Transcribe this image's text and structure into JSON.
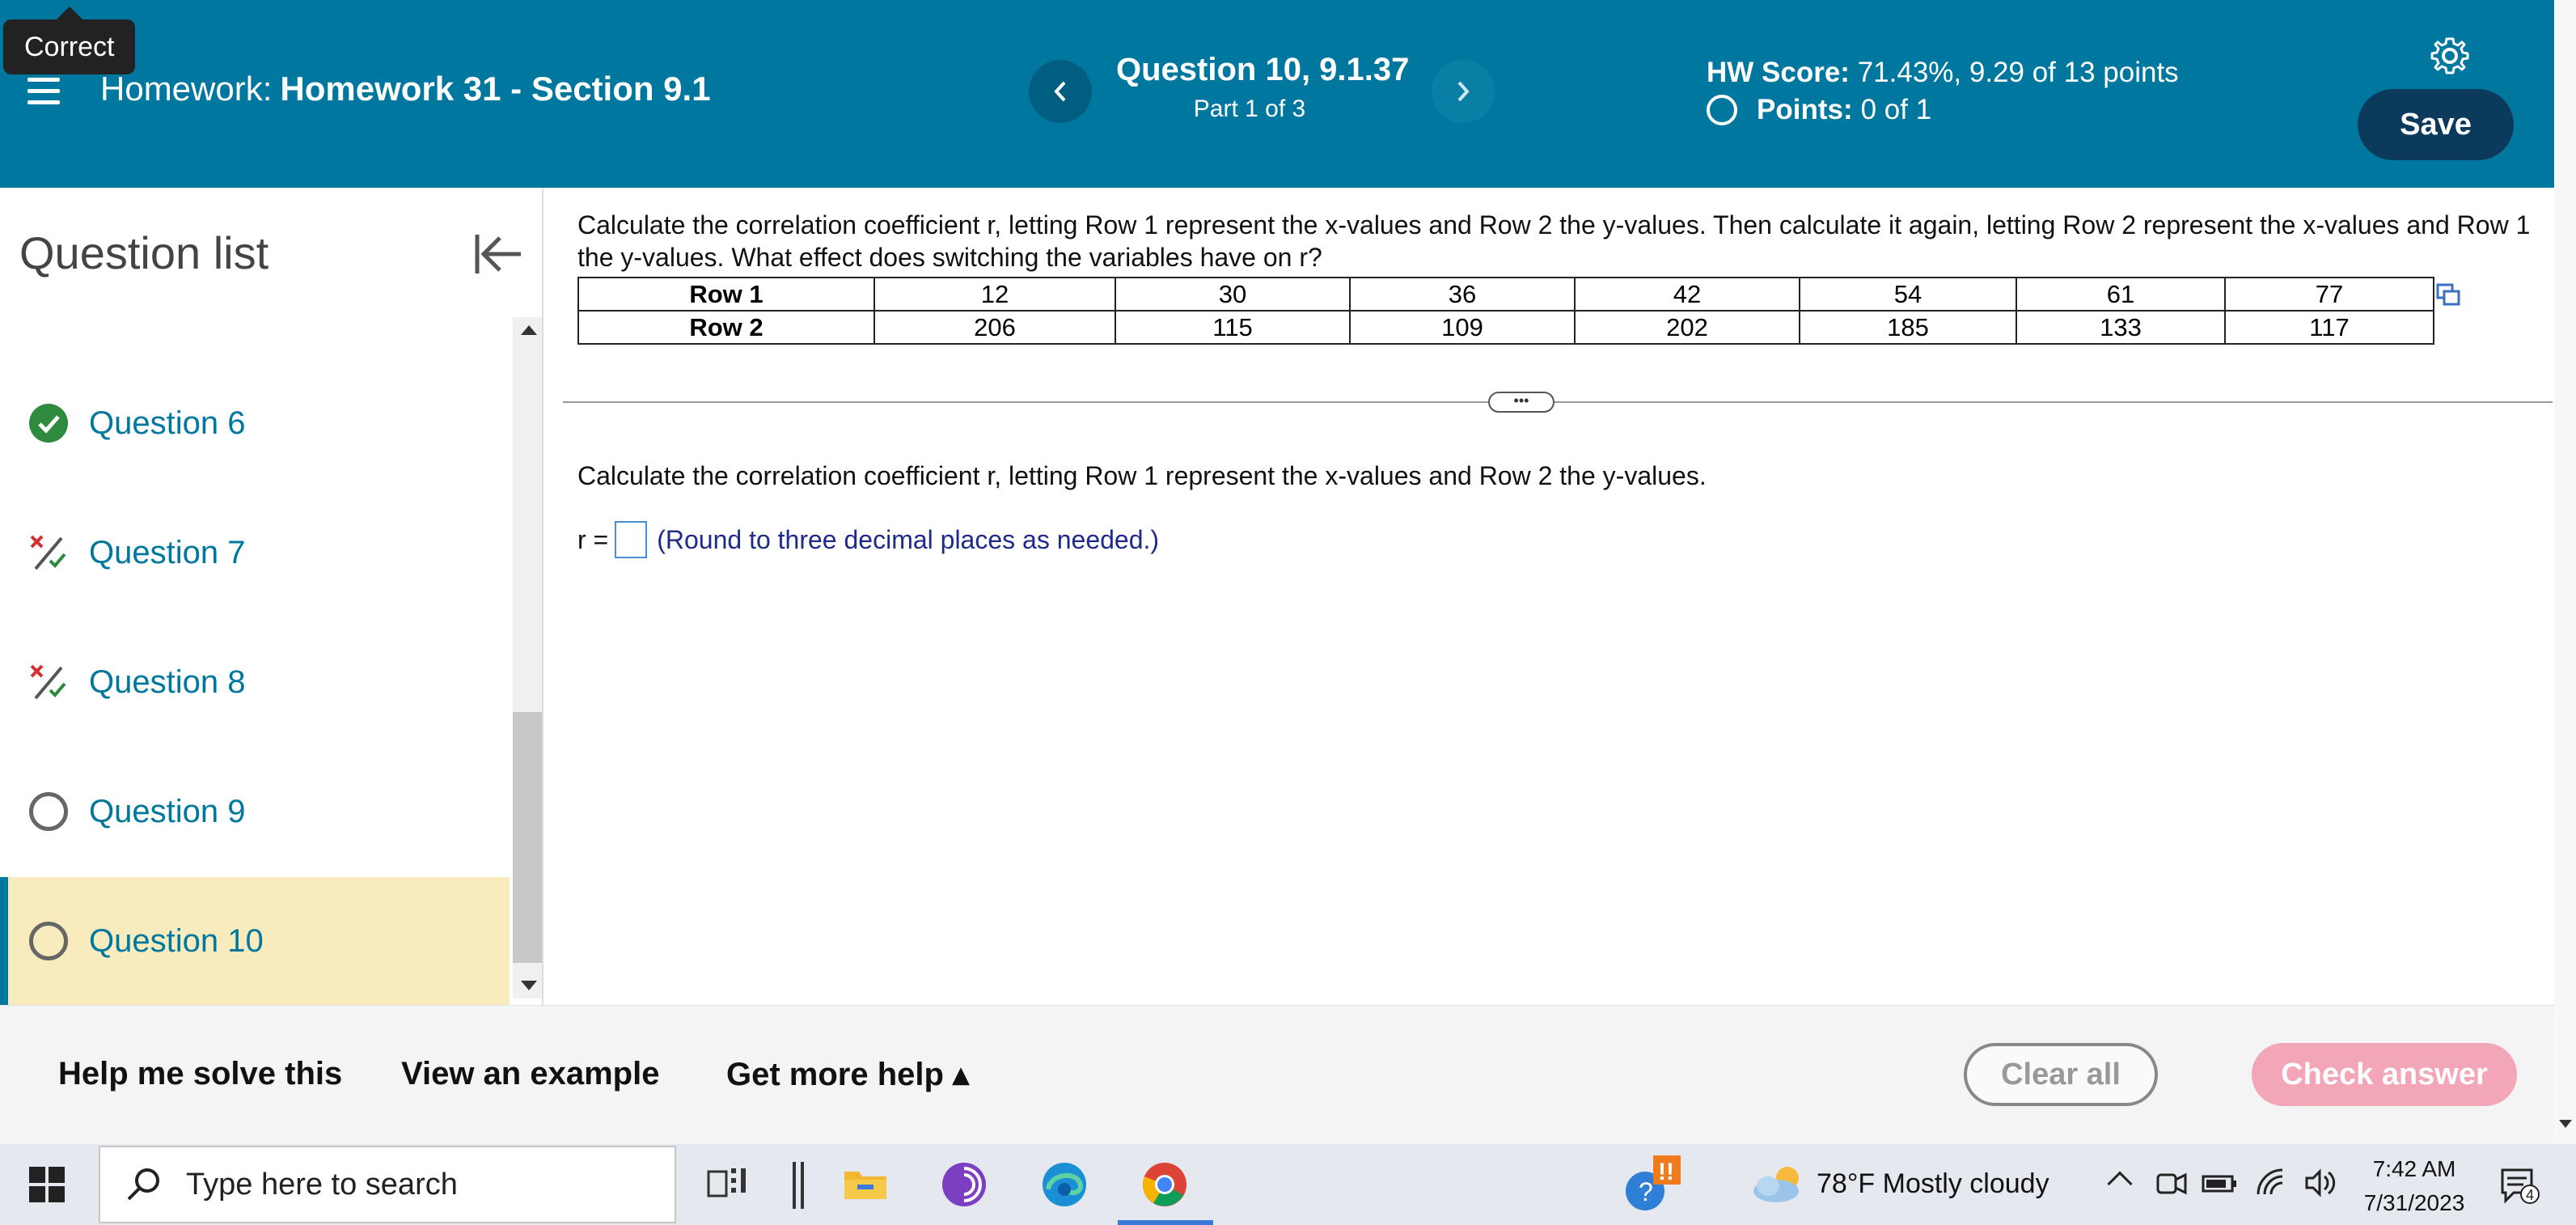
{
  "tooltip": "Correct",
  "header": {
    "hw_prefix": "Homework:",
    "hw_name": "Homework 31 - Section 9.1",
    "question_title": "Question 10, 9.1.37",
    "question_part": "Part 1 of 3",
    "hw_score_label": "HW Score:",
    "hw_score_value": "71.43%, 9.29 of 13 points",
    "points_label": "Points:",
    "points_value": "0 of 1",
    "save_label": "Save",
    "prev_icon": "chevron-left-icon",
    "next_icon": "chevron-right-icon"
  },
  "sidebar": {
    "title": "Question list",
    "items": [
      {
        "label": "Question 6",
        "status": "correct"
      },
      {
        "label": "Question 7",
        "status": "partial"
      },
      {
        "label": "Question 8",
        "status": "partial"
      },
      {
        "label": "Question 9",
        "status": "unanswered"
      },
      {
        "label": "Question 10",
        "status": "current"
      }
    ]
  },
  "main": {
    "prompt": "Calculate the correlation coefficient r, letting Row 1 represent the x-values and Row 2 the y-values. Then calculate it again, letting Row 2 represent the x-values and Row 1 the y-values. What effect does switching the variables have on r?",
    "table": {
      "rows": [
        {
          "header": "Row 1",
          "cells": [
            "12",
            "30",
            "36",
            "42",
            "54",
            "61",
            "77"
          ]
        },
        {
          "header": "Row 2",
          "cells": [
            "206",
            "115",
            "109",
            "202",
            "185",
            "133",
            "117"
          ]
        }
      ]
    },
    "expander": "•••",
    "sub_prompt": "Calculate the correlation coefficient r, letting Row 1 represent the x-values and Row 2 the y-values.",
    "answer_prefix": "r =",
    "answer_value": "",
    "answer_hint": "(Round to three decimal places as needed.)"
  },
  "bottom_bar": {
    "help_solve": "Help me solve this",
    "view_example": "View an example",
    "more_help": "Get more help ▴",
    "clear_all": "Clear all",
    "check_answer": "Check answer"
  },
  "taskbar": {
    "search_placeholder": "Type here to search",
    "weather": "78°F  Mostly cloudy",
    "time": "7:42 AM",
    "date": "7/31/2023",
    "notification_count": "4"
  },
  "colors": {
    "header_bg": "#00779e",
    "save_bg": "#0b3a5c",
    "active_item_bg": "#f8ecbe",
    "link_color": "#00779e",
    "check_answer_bg": "#f2a6b8",
    "hint_color": "#1d2a8a"
  }
}
